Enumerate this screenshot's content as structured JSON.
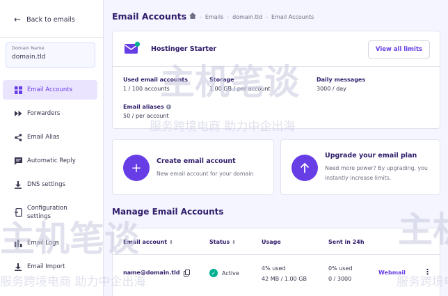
{
  "sidebar": {
    "back_label": "Back to emails",
    "domain_label": "Domain Name",
    "domain_value": "domain.tld",
    "items": [
      {
        "label": "Email Accounts",
        "icon": "grid-icon"
      },
      {
        "label": "Forwarders",
        "icon": "fast-forward-icon"
      },
      {
        "label": "Email Alias",
        "icon": "share-icon"
      },
      {
        "label": "Automatic Reply",
        "icon": "message-icon"
      },
      {
        "label": "DNS settings",
        "icon": "download-icon"
      },
      {
        "label": "Configuration settings",
        "icon": "config-icon"
      },
      {
        "label": "Email Logs",
        "icon": "bar-chart-icon"
      },
      {
        "label": "Email Import",
        "icon": "import-icon"
      }
    ]
  },
  "header": {
    "title": "Email Accounts",
    "breadcrumb": [
      "Emails",
      "domain.tld",
      "Email Accounts"
    ]
  },
  "plan": {
    "name": "Hostinger Starter",
    "view_limits_label": "View all limits",
    "stats": [
      {
        "label": "Used email accounts",
        "value": "1 / 100 accounts"
      },
      {
        "label": "Storage",
        "value": "1.00 GB / per account"
      },
      {
        "label": "Daily messages",
        "value": "3000 / day"
      },
      {
        "label": "Email aliases",
        "value": "50 / per account"
      }
    ]
  },
  "actions": {
    "create": {
      "title": "Create email account",
      "desc": "New email account for your domain"
    },
    "upgrade": {
      "title": "Upgrade your email plan",
      "desc_line1": "Need more power? By upgrading, you",
      "desc_line2": "instantly increase limits."
    }
  },
  "manage": {
    "title": "Manage Email Accounts",
    "columns": {
      "account": "Email account",
      "status": "Status",
      "usage": "Usage",
      "sent": "Sent in 24h"
    },
    "rows": [
      {
        "account": "name@domain.tld",
        "status": "Active",
        "usage_pct": "4% used",
        "usage_size": "42 MB / 1.00 GB",
        "sent_pct": "0% used",
        "sent_count": "0 / 3000",
        "action": "Webmail"
      }
    ]
  },
  "watermark": {
    "logo_text": "主机笔谈",
    "tagline": "服务跨境电商 助力中企出海"
  },
  "colors": {
    "accent": "#673de6",
    "success": "#00b090",
    "text": "#2f1c6a"
  }
}
